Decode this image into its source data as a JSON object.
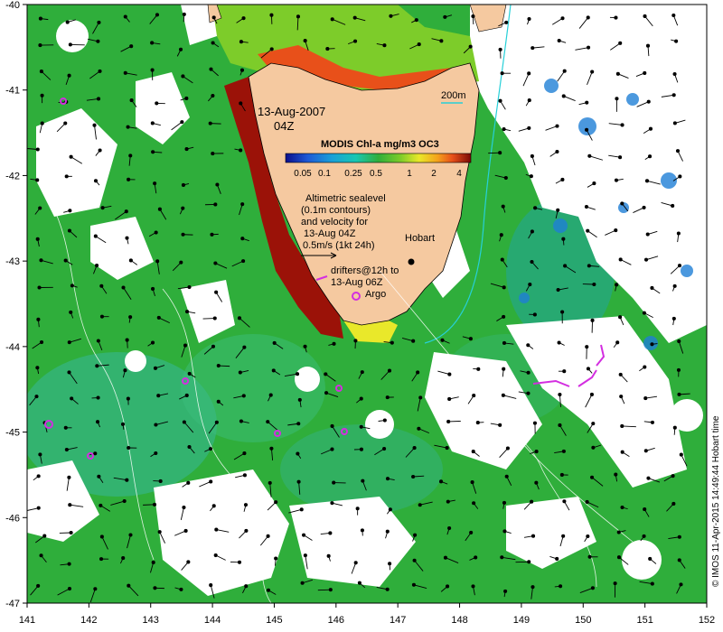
{
  "map": {
    "date_label": "13-Aug-2007",
    "time_label": "04Z",
    "colorbar": {
      "title": "MODIS Chl-a mg/m3 OC3",
      "tick_labels": [
        "0.05",
        "0.1",
        "0.25",
        "0.5",
        "1",
        "2",
        "4"
      ],
      "colors": [
        "#0b0f8c",
        "#1f5ad6",
        "#1aa0d8",
        "#19c7b2",
        "#25c06a",
        "#2fae3b",
        "#7dcc2a",
        "#e9e82a",
        "#f4a21c",
        "#e8501a",
        "#b4140c",
        "#7a0a06"
      ]
    },
    "isobath_label": "200m",
    "altimetry_note": [
      "Altimetric sealevel",
      "(0.1m contours)",
      "and velocity for",
      "13-Aug 04Z",
      "0.5m/s (1kt 24h)"
    ],
    "drifter_note": [
      "drifters@12h to",
      "13-Aug 06Z"
    ],
    "argo_label": "Argo",
    "city_label": "Hobart",
    "credit": "© IMOS 11-Apr-2015 14:49:44 Hobart time",
    "x_ticks": [
      "141",
      "142",
      "143",
      "144",
      "145",
      "146",
      "147",
      "148",
      "149",
      "150",
      "151",
      "152"
    ],
    "y_ticks": [
      "-40",
      "-41",
      "-42",
      "-43",
      "-44",
      "-45",
      "-46",
      "-47"
    ],
    "colors": {
      "ocean_green": "#2fae3b",
      "land": "#f5c9a0",
      "high_chl": "#9b1208",
      "drifter": "#d32ee0",
      "contour": "#ffffff",
      "isobath": "#27d0d8"
    }
  }
}
